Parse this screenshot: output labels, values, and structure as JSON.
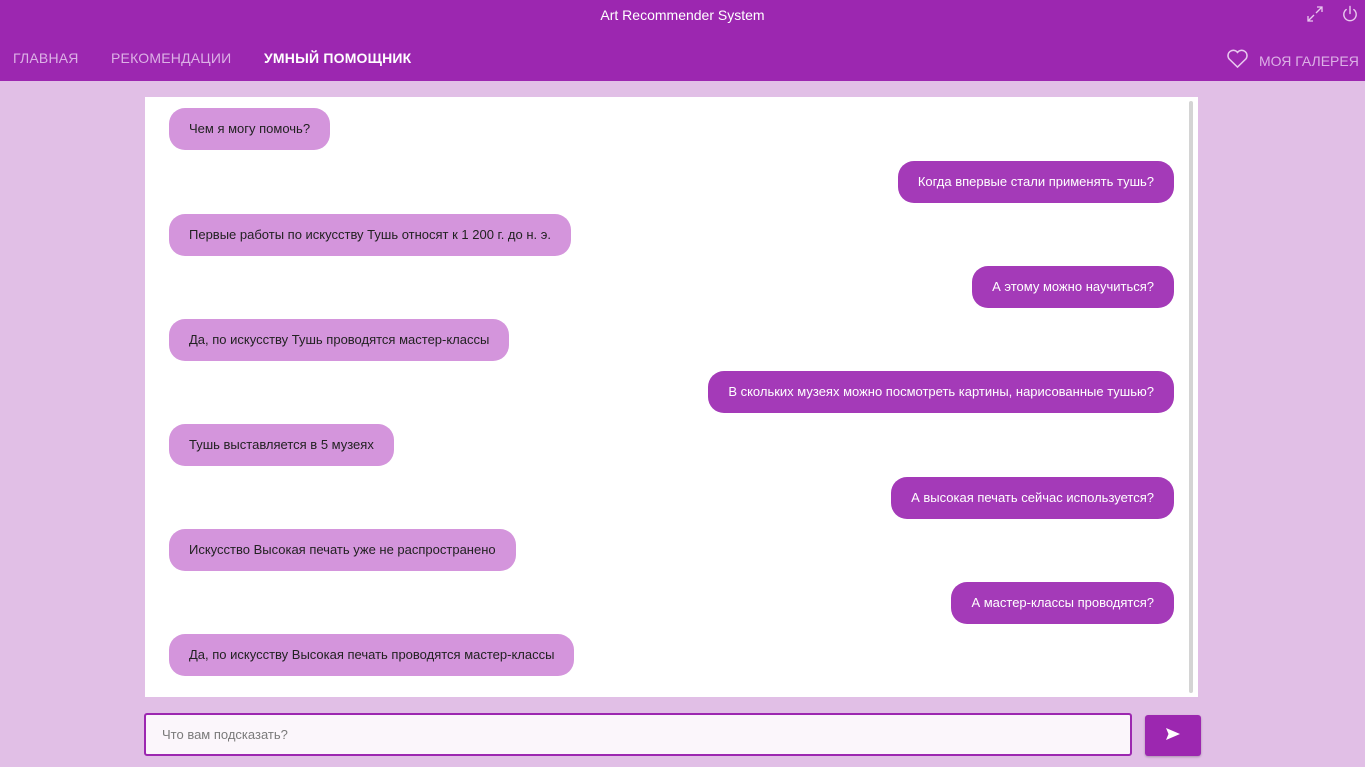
{
  "window": {
    "title": "Art Recommender System"
  },
  "nav": {
    "items": [
      {
        "label": "ГЛАВНАЯ",
        "active": false
      },
      {
        "label": "РЕКОМЕНДАЦИИ",
        "active": false
      },
      {
        "label": "УМНЫЙ ПОМОЩНИК",
        "active": true
      }
    ],
    "gallery_label": "МОЯ ГАЛЕРЕЯ"
  },
  "chat": {
    "messages": [
      {
        "role": "bot",
        "text": "Чем я могу помочь?"
      },
      {
        "role": "user",
        "text": "Когда впервые стали применять тушь?"
      },
      {
        "role": "bot",
        "text": "Первые работы по искусству Тушь относят к 1 200 г. до н. э."
      },
      {
        "role": "user",
        "text": "А этому можно научиться?"
      },
      {
        "role": "bot",
        "text": "Да, по искусству Тушь проводятся мастер-классы"
      },
      {
        "role": "user",
        "text": "В скольких музеях можно посмотреть картины, нарисованные тушью?"
      },
      {
        "role": "bot",
        "text": "Тушь выставляется в 5 музеях"
      },
      {
        "role": "user",
        "text": "А высокая печать сейчас используется?"
      },
      {
        "role": "bot",
        "text": "Искусство Высокая печать уже не распространено"
      },
      {
        "role": "user",
        "text": "А мастер-классы проводятся?"
      },
      {
        "role": "bot",
        "text": "Да, по искусству Высокая печать проводятся мастер-классы"
      }
    ]
  },
  "input": {
    "value": "",
    "placeholder": "Что вам подсказать?"
  },
  "icons": {
    "fullscreen": "fullscreen-icon",
    "power": "power-icon",
    "heart": "heart-icon",
    "send": "send-icon"
  },
  "colors": {
    "header": "#9c27b0",
    "background": "#e1bfe6",
    "bot_bubble": "#d495dc",
    "user_bubble": "#a43ab8",
    "nav_inactive": "#dcb1e6"
  }
}
